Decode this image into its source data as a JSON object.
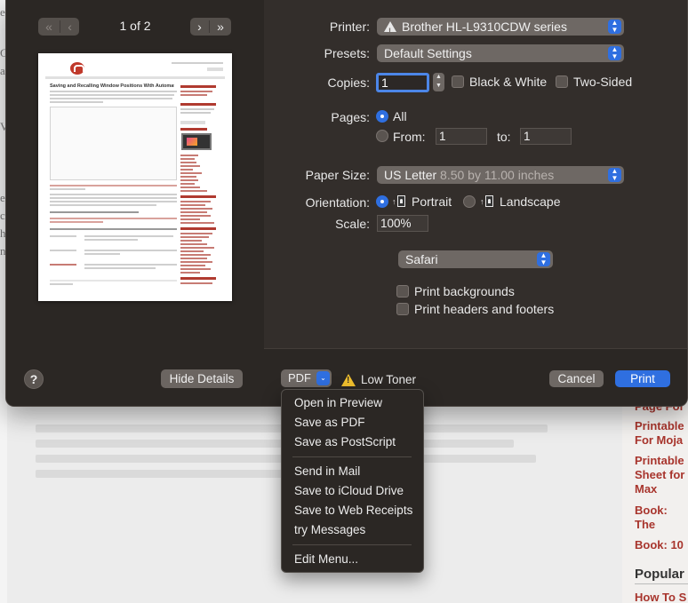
{
  "background_page": {
    "left_letters": [
      "e",
      "G",
      "a",
      "V",
      "e",
      "c",
      "h",
      "n"
    ],
    "sidebar_links": [
      "Page For",
      "Printable For Moja",
      "Printable Sheet for Max",
      "Book: The Security",
      "Book: 10"
    ],
    "popular_heading": "Popular",
    "howto_link": "How To S"
  },
  "preview": {
    "page_indicator": "1 of 2",
    "first_label": "«",
    "prev_label": "‹",
    "next_label": "›",
    "last_label": "»",
    "page_title": "Saving and Recalling Window Positions With Automator"
  },
  "settings": {
    "printer_label": "Printer:",
    "printer_value": "Brother HL-L9310CDW series",
    "presets_label": "Presets:",
    "presets_value": "Default Settings",
    "copies_label": "Copies:",
    "copies_value": "1",
    "black_white_label": "Black & White",
    "two_sided_label": "Two-Sided",
    "pages_label": "Pages:",
    "pages_all_label": "All",
    "pages_from_label": "From:",
    "pages_from_value": "1",
    "pages_to_label": "to:",
    "pages_to_value": "1",
    "paper_size_label": "Paper Size:",
    "paper_size_value": "US Letter",
    "paper_size_detail": "8.50 by 11.00 inches",
    "orientation_label": "Orientation:",
    "portrait_label": "Portrait",
    "landscape_label": "Landscape",
    "scale_label": "Scale:",
    "scale_value": "100%",
    "app_section_value": "Safari",
    "print_backgrounds_label": "Print backgrounds",
    "print_headers_label": "Print headers and footers"
  },
  "footer": {
    "help_label": "?",
    "hide_details_label": "Hide Details",
    "pdf_label": "PDF",
    "toner_label": "Low Toner",
    "cancel_label": "Cancel",
    "print_label": "Print"
  },
  "pdf_menu": {
    "items": [
      "Open in Preview",
      "Save as PDF",
      "Save as PostScript",
      "Send in Mail",
      "Save to iCloud Drive",
      "Save to Web Receipts",
      "try Messages",
      "Edit Menu..."
    ]
  },
  "colors": {
    "accent": "#2f6fe0",
    "dialog_bg": "#332e2b",
    "warning": "#f2c12e",
    "link_red": "#a8352d"
  },
  "icons": [
    "warning-icon",
    "chevron-updown-icon",
    "portrait-icon",
    "landscape-icon",
    "help-icon"
  ]
}
